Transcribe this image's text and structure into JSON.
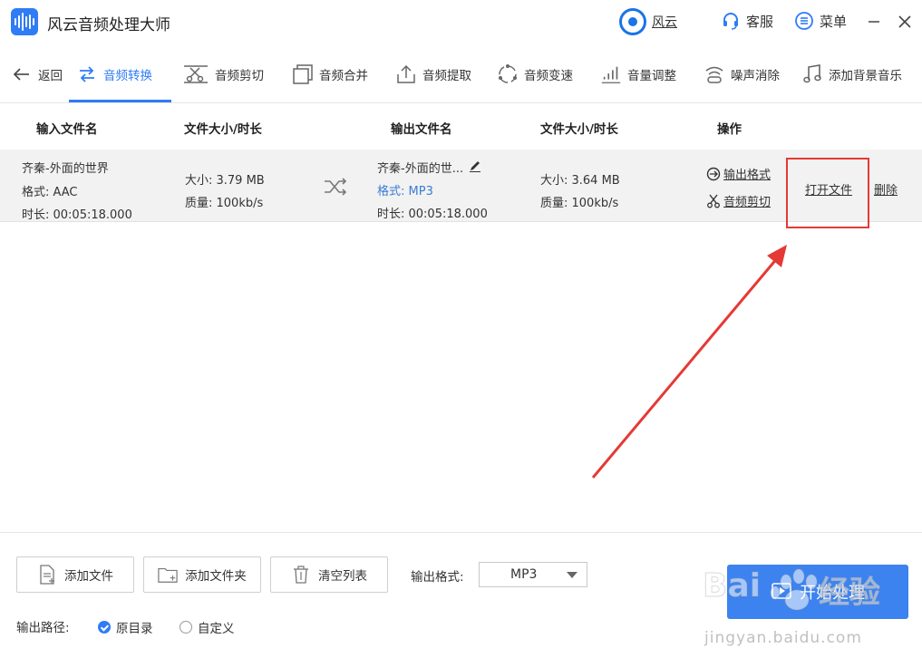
{
  "titlebar": {
    "app_title": "风云音频处理大师",
    "fengyun": "风云",
    "service": "客服",
    "menu": "菜单"
  },
  "toolbar": {
    "back": "返回",
    "items": [
      "音频转换",
      "音频剪切",
      "音频合并",
      "音频提取",
      "音频变速",
      "音量调整",
      "噪声消除",
      "添加背景音乐"
    ]
  },
  "table": {
    "headers": {
      "input_name": "输入文件名",
      "size_duration_in": "文件大小/时长",
      "output_name": "输出文件名",
      "size_duration_out": "文件大小/时长",
      "ops": "操作"
    },
    "rows": [
      {
        "input": {
          "name": "齐秦-外面的世界",
          "format": "格式: AAC",
          "duration": "时长: 00:05:18.000"
        },
        "input_size": {
          "size": "大小: 3.79 MB",
          "quality": "质量: 100kb/s"
        },
        "output": {
          "name": "齐秦-外面的世...",
          "format": "格式: MP3",
          "duration": "时长: 00:05:18.000"
        },
        "output_size": {
          "size": "大小: 3.64 MB",
          "quality": "质量: 100kb/s"
        },
        "ops": {
          "output_format": "输出格式",
          "audio_cut": "音频剪切",
          "open_file": "打开文件",
          "delete": "删除"
        }
      }
    ]
  },
  "bottom": {
    "add_file": "添加文件",
    "add_folder": "添加文件夹",
    "clear_list": "清空列表",
    "output_format_label": "输出格式:",
    "output_format_value": "MP3",
    "start": "开始处理",
    "output_path_label": "输出路径:",
    "radio_original": "原目录",
    "radio_custom": "自定义"
  },
  "watermark": {
    "text1": "Bai",
    "text2": "经验",
    "url": "jingyan.baidu.com"
  },
  "colors": {
    "accent": "#2f7cf6",
    "annotation_red": "#e53935",
    "start_button": "#3c83ef"
  }
}
